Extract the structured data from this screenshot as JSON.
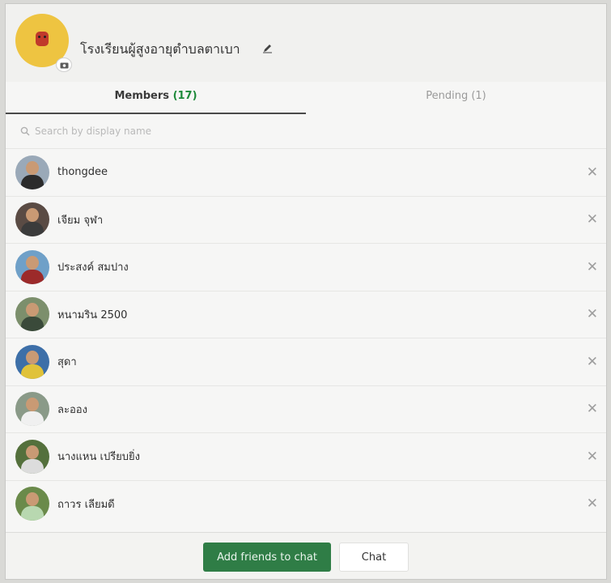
{
  "header": {
    "group_name": "โรงเรียนผู้สูงอายุตำบลตาเบา",
    "edit_icon": "pencil-icon",
    "camera_icon": "camera-icon"
  },
  "tabs": [
    {
      "label": "Members",
      "count": "(17)",
      "active": true
    },
    {
      "label": "Pending (1)",
      "active": false
    }
  ],
  "search": {
    "placeholder": "Search by display name",
    "icon": "search-icon"
  },
  "members": [
    {
      "name": "thongdee",
      "avatar_bg": "#9aa9b8",
      "avatar_shirt": "#2b2b2b"
    },
    {
      "name": "เจียม จุฬา",
      "avatar_bg": "#5a4b44",
      "avatar_shirt": "#3b3b3b"
    },
    {
      "name": "ประสงค์ สมปาง",
      "avatar_bg": "#6fa0c8",
      "avatar_shirt": "#9c2a2a"
    },
    {
      "name": "หนามริน 2500",
      "avatar_bg": "#7c8f6c",
      "avatar_shirt": "#3a4a3a"
    },
    {
      "name": "สุดา",
      "avatar_bg": "#3d6fa8",
      "avatar_shirt": "#e0c23a"
    },
    {
      "name": "ละออง",
      "avatar_bg": "#8a9a88",
      "avatar_shirt": "#f0f0f0"
    },
    {
      "name": "นางแหน เปรียบยิ่ง",
      "avatar_bg": "#54703c",
      "avatar_shirt": "#dcdcdc"
    },
    {
      "name": "ถาวร เลียมดี",
      "avatar_bg": "#6a8a4a",
      "avatar_shirt": "#b8d8b0"
    }
  ],
  "remove_icon": "close-icon",
  "footer": {
    "add_label": "Add friends to chat",
    "chat_label": "Chat"
  },
  "colors": {
    "accent": "#2f7d46",
    "member_count": "#1e8a3a",
    "group_avatar": "#eec441"
  }
}
